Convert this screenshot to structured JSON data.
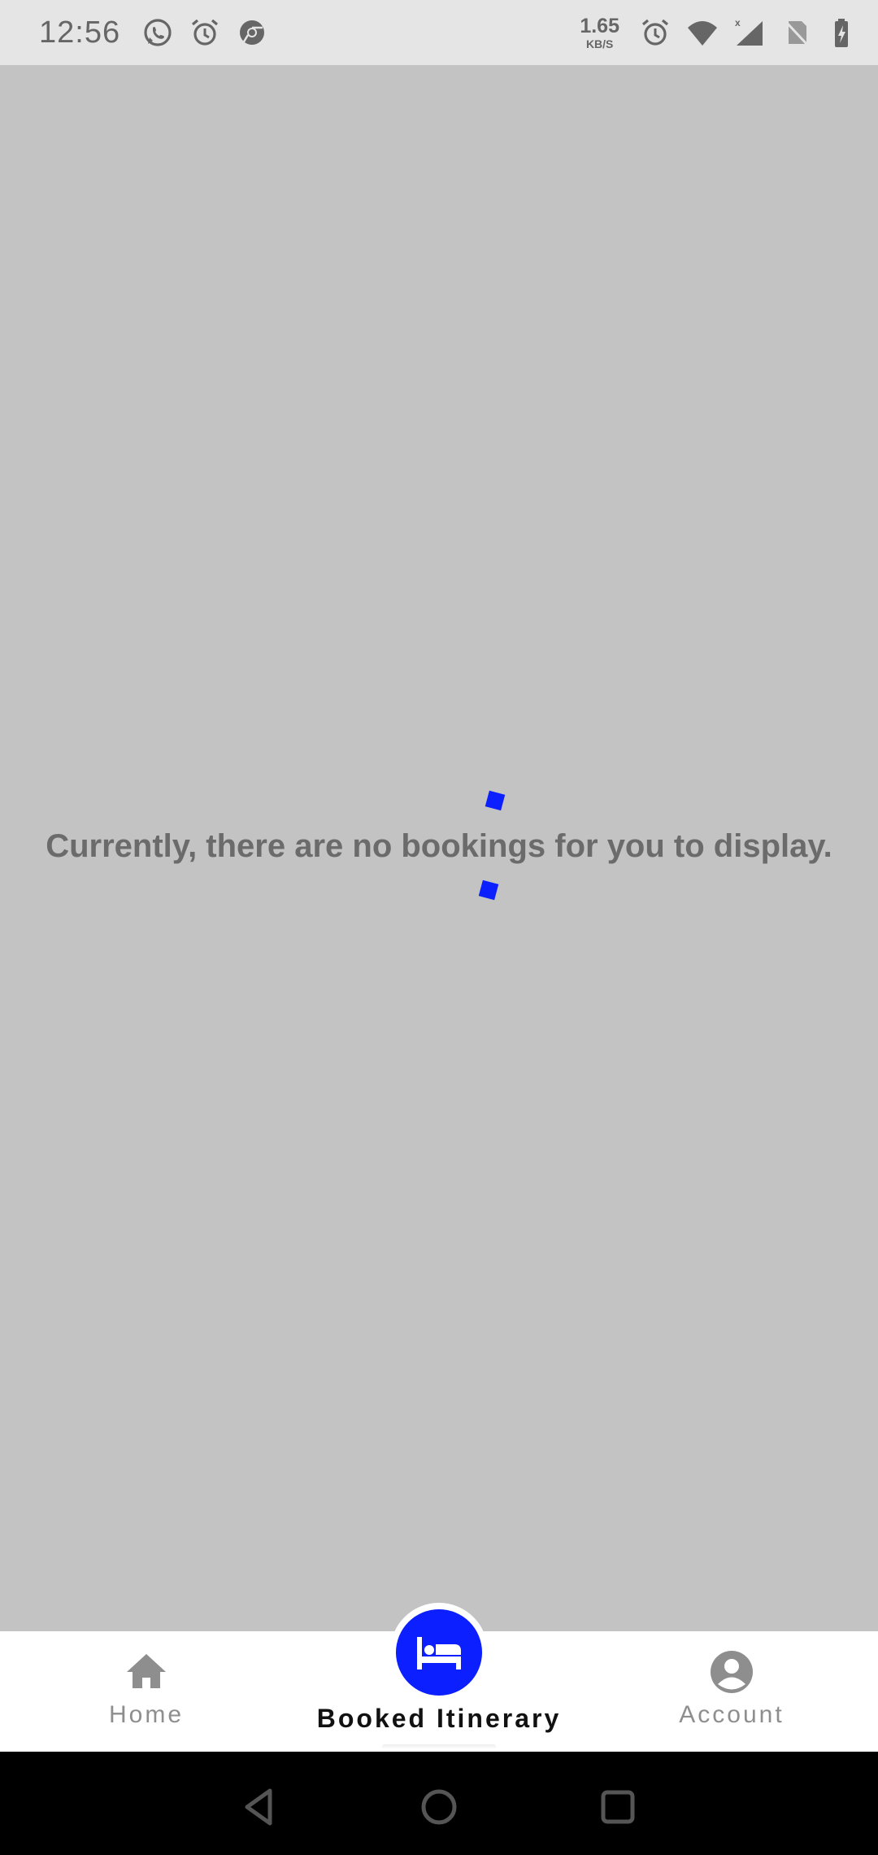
{
  "status_bar": {
    "time": "12:56",
    "left_icons": [
      "whatsapp-icon",
      "alarm-icon",
      "chrome-icon"
    ],
    "net_speed_value": "1.65",
    "net_speed_unit": "KB/S",
    "right_icons": [
      "alarm-icon",
      "wifi-icon",
      "signal-icon",
      "no-sim-icon",
      "battery-charging-icon"
    ]
  },
  "main": {
    "empty_message": "Currently, there are no bookings for you to display."
  },
  "bottom_nav": {
    "items": [
      {
        "label": "Home",
        "icon": "home-icon",
        "active": false
      },
      {
        "label": "Booked Itinerary",
        "icon": "bed-icon",
        "active": true
      },
      {
        "label": "Account",
        "icon": "account-circle-icon",
        "active": false
      }
    ]
  },
  "system_nav": {
    "buttons": [
      "back-icon",
      "home-circle-icon",
      "recents-icon"
    ]
  },
  "colors": {
    "accent": "#0b1fff",
    "background": "#c3c3c3",
    "status_bar": "#e5e5e5",
    "nav_bar": "#ffffff",
    "message_text": "#6b6b6b",
    "inactive_nav": "#8e8e8e"
  }
}
